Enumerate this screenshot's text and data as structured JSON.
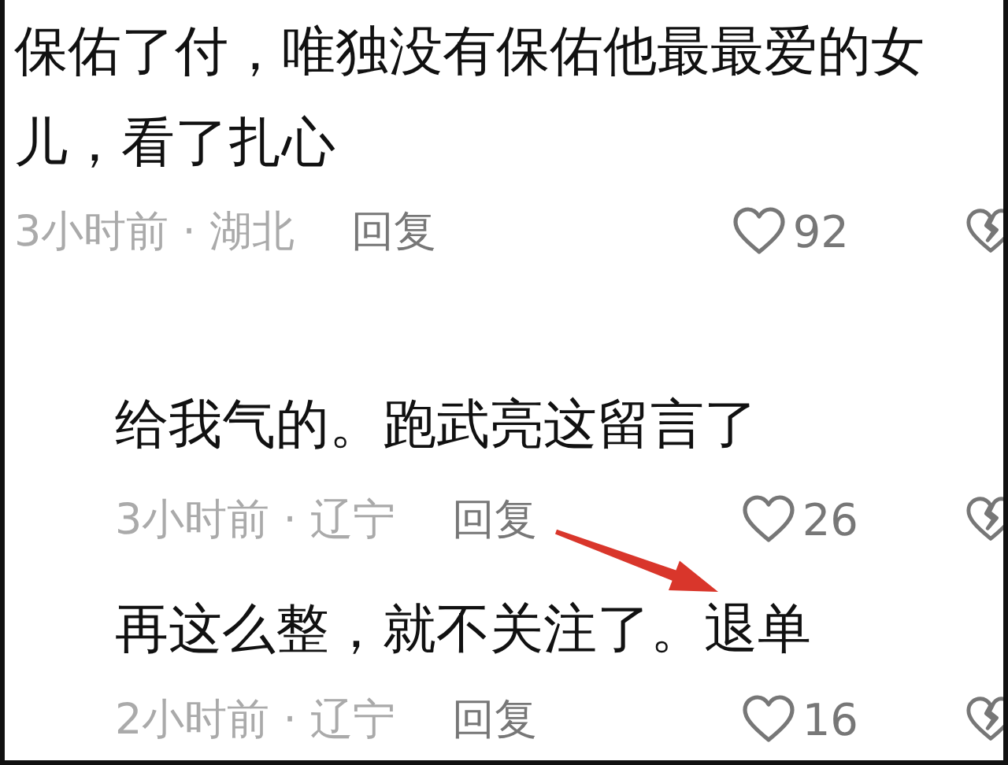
{
  "comments": [
    {
      "text": "保佑了付，唯独没有保佑他最最爱的女儿，看了扎心",
      "time": "3小时前",
      "separator": "·",
      "location": "湖北",
      "reply": "回复",
      "likes": "92",
      "children": [
        {
          "text": "给我气的。跑武亮这留言了",
          "time": "3小时前",
          "separator": "·",
          "location": "辽宁",
          "reply": "回复",
          "likes": "26"
        },
        {
          "text": "再这么整，就不关注了。退单",
          "time": "2小时前",
          "separator": "·",
          "location": "辽宁",
          "reply": "回复",
          "likes": "16"
        }
      ]
    }
  ],
  "annotation": {
    "kind": "arrow"
  }
}
